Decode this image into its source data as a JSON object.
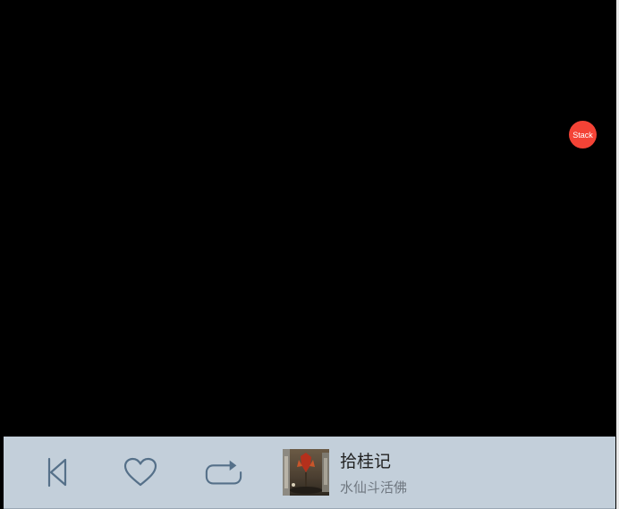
{
  "floating_button": {
    "label": "Stack",
    "color": "#f44336"
  },
  "player": {
    "background": "#c3cfda",
    "icon_color": "#557089",
    "controls": [
      {
        "name": "previous",
        "icon": "skip-previous-icon"
      },
      {
        "name": "like",
        "icon": "heart-outline-icon"
      },
      {
        "name": "repeat",
        "icon": "repeat-icon"
      }
    ],
    "track": {
      "title": "拾桂记",
      "artist": "水仙斗活佛"
    }
  }
}
